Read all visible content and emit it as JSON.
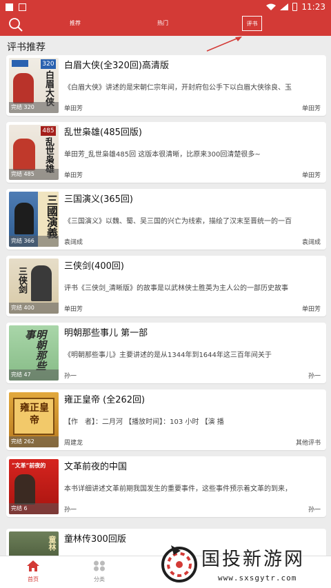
{
  "status_bar": {
    "time": "11:23"
  },
  "header": {
    "tabs": [
      {
        "label": "推荐"
      },
      {
        "label": "热门"
      },
      {
        "label": "评书"
      }
    ]
  },
  "section_title": "评书推荐",
  "books": [
    {
      "title": "白眉大侠(全320回)高清版",
      "desc": "《白眉大侠》讲述的是宋朝仁宗年间，开封府包公手下以白眉大侠徐良、玉",
      "author": "单田芳",
      "source": "单田芳",
      "badge": "完结 320",
      "cover_text": "白眉大侠",
      "cover_num": "320"
    },
    {
      "title": "乱世枭雄(485回版)",
      "desc": "单田芳_乱世枭雄485回 这版本很清晰，比原来300回清楚很多~",
      "author": "单田芳",
      "source": "单田芳",
      "badge": "完结 485",
      "cover_text": "乱世枭雄",
      "cover_num": "485"
    },
    {
      "title": "三国演义(365回)",
      "desc": "《三国演义》以魏、蜀、吴三国的兴亡为线索，描绘了汉末至晋统一的一百",
      "author": "袁阔成",
      "source": "袁阔成",
      "badge": "完结 366",
      "cover_text": "三國演義",
      "cover_num": ""
    },
    {
      "title": "三侠剑(400回)",
      "desc": "评书《三侠剑_清晰版》的故事是以武林侠士胜英为主人公的一部历史故事",
      "author": "单田芳",
      "source": "单田芳",
      "badge": "完结 400",
      "cover_text": "三侠剑",
      "cover_num": ""
    },
    {
      "title": "明朝那些事儿 第一部",
      "desc": "《明朝那些事儿》主要讲述的是从1344年到1644年这三百年间关于",
      "author": "孙一",
      "source": "孙一",
      "badge": "完结 47",
      "cover_text": "明朝那些事",
      "cover_num": ""
    },
    {
      "title": "雍正皇帝 (全262回)",
      "desc": "【作　者】：二月河 【播放时间】：103 小时 【演 播",
      "author": "周建龙",
      "source": "其他评书",
      "badge": "完结 262",
      "cover_text": "雍正皇帝",
      "cover_num": ""
    },
    {
      "title": "文革前夜的中国",
      "desc": "本书详细讲述文革前期我国发生的重要事件，这些事件预示着文革的到来，",
      "author": "孙一",
      "source": "孙一",
      "badge": "完结 6",
      "cover_text": "“文革”前夜的",
      "cover_num": ""
    },
    {
      "title": "童林传300回版",
      "desc": "",
      "author": "",
      "source": "",
      "badge": "",
      "cover_text": "童林",
      "cover_num": ""
    }
  ],
  "bottom_nav": {
    "home": "首页",
    "category": "分类"
  },
  "watermark": {
    "text": "国投新游网",
    "url": "www.sxsgytr.com"
  },
  "colors": {
    "brand": "#d33a36"
  }
}
